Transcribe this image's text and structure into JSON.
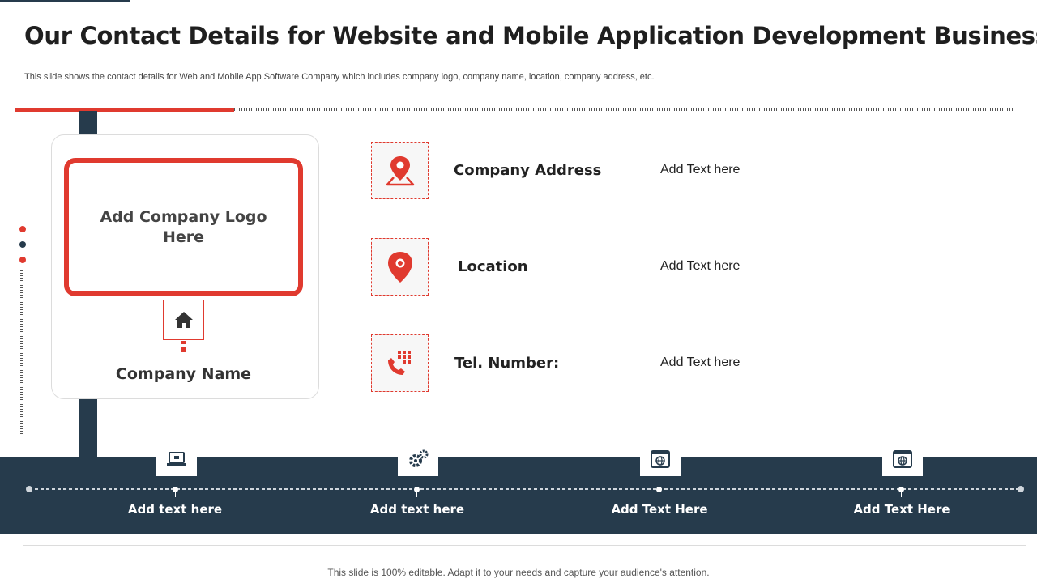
{
  "slide": {
    "title": "Our Contact Details for Website and Mobile Application Development Business",
    "subtitle": "This slide shows the contact details for Web and Mobile App Software Company which includes company logo, company name, location, company address, etc.",
    "footer": "This slide is 100% editable. Adapt it to your needs and capture your audience's attention."
  },
  "company": {
    "logo_placeholder": "Add Company Logo Here",
    "name": "Company Name",
    "icon": "home-icon"
  },
  "contacts": [
    {
      "label": "Company Address",
      "value": "Add Text here",
      "icon": "map-pin-icon"
    },
    {
      "label": "Location",
      "value": "Add Text here",
      "icon": "location-pin-icon"
    },
    {
      "label": "Tel. Number:",
      "value": "Add Text here",
      "icon": "phone-dialpad-icon"
    }
  ],
  "features": [
    {
      "label": "Add text here",
      "icon": "laptop-icon"
    },
    {
      "label": "Add text here",
      "icon": "gears-icon"
    },
    {
      "label": "Add Text Here",
      "icon": "browser-globe-icon"
    },
    {
      "label": "Add Text Here",
      "icon": "browser-globe-icon"
    }
  ],
  "colors": {
    "accent_red": "#e03a2f",
    "navy": "#263b4c",
    "text_dark": "#222222"
  }
}
